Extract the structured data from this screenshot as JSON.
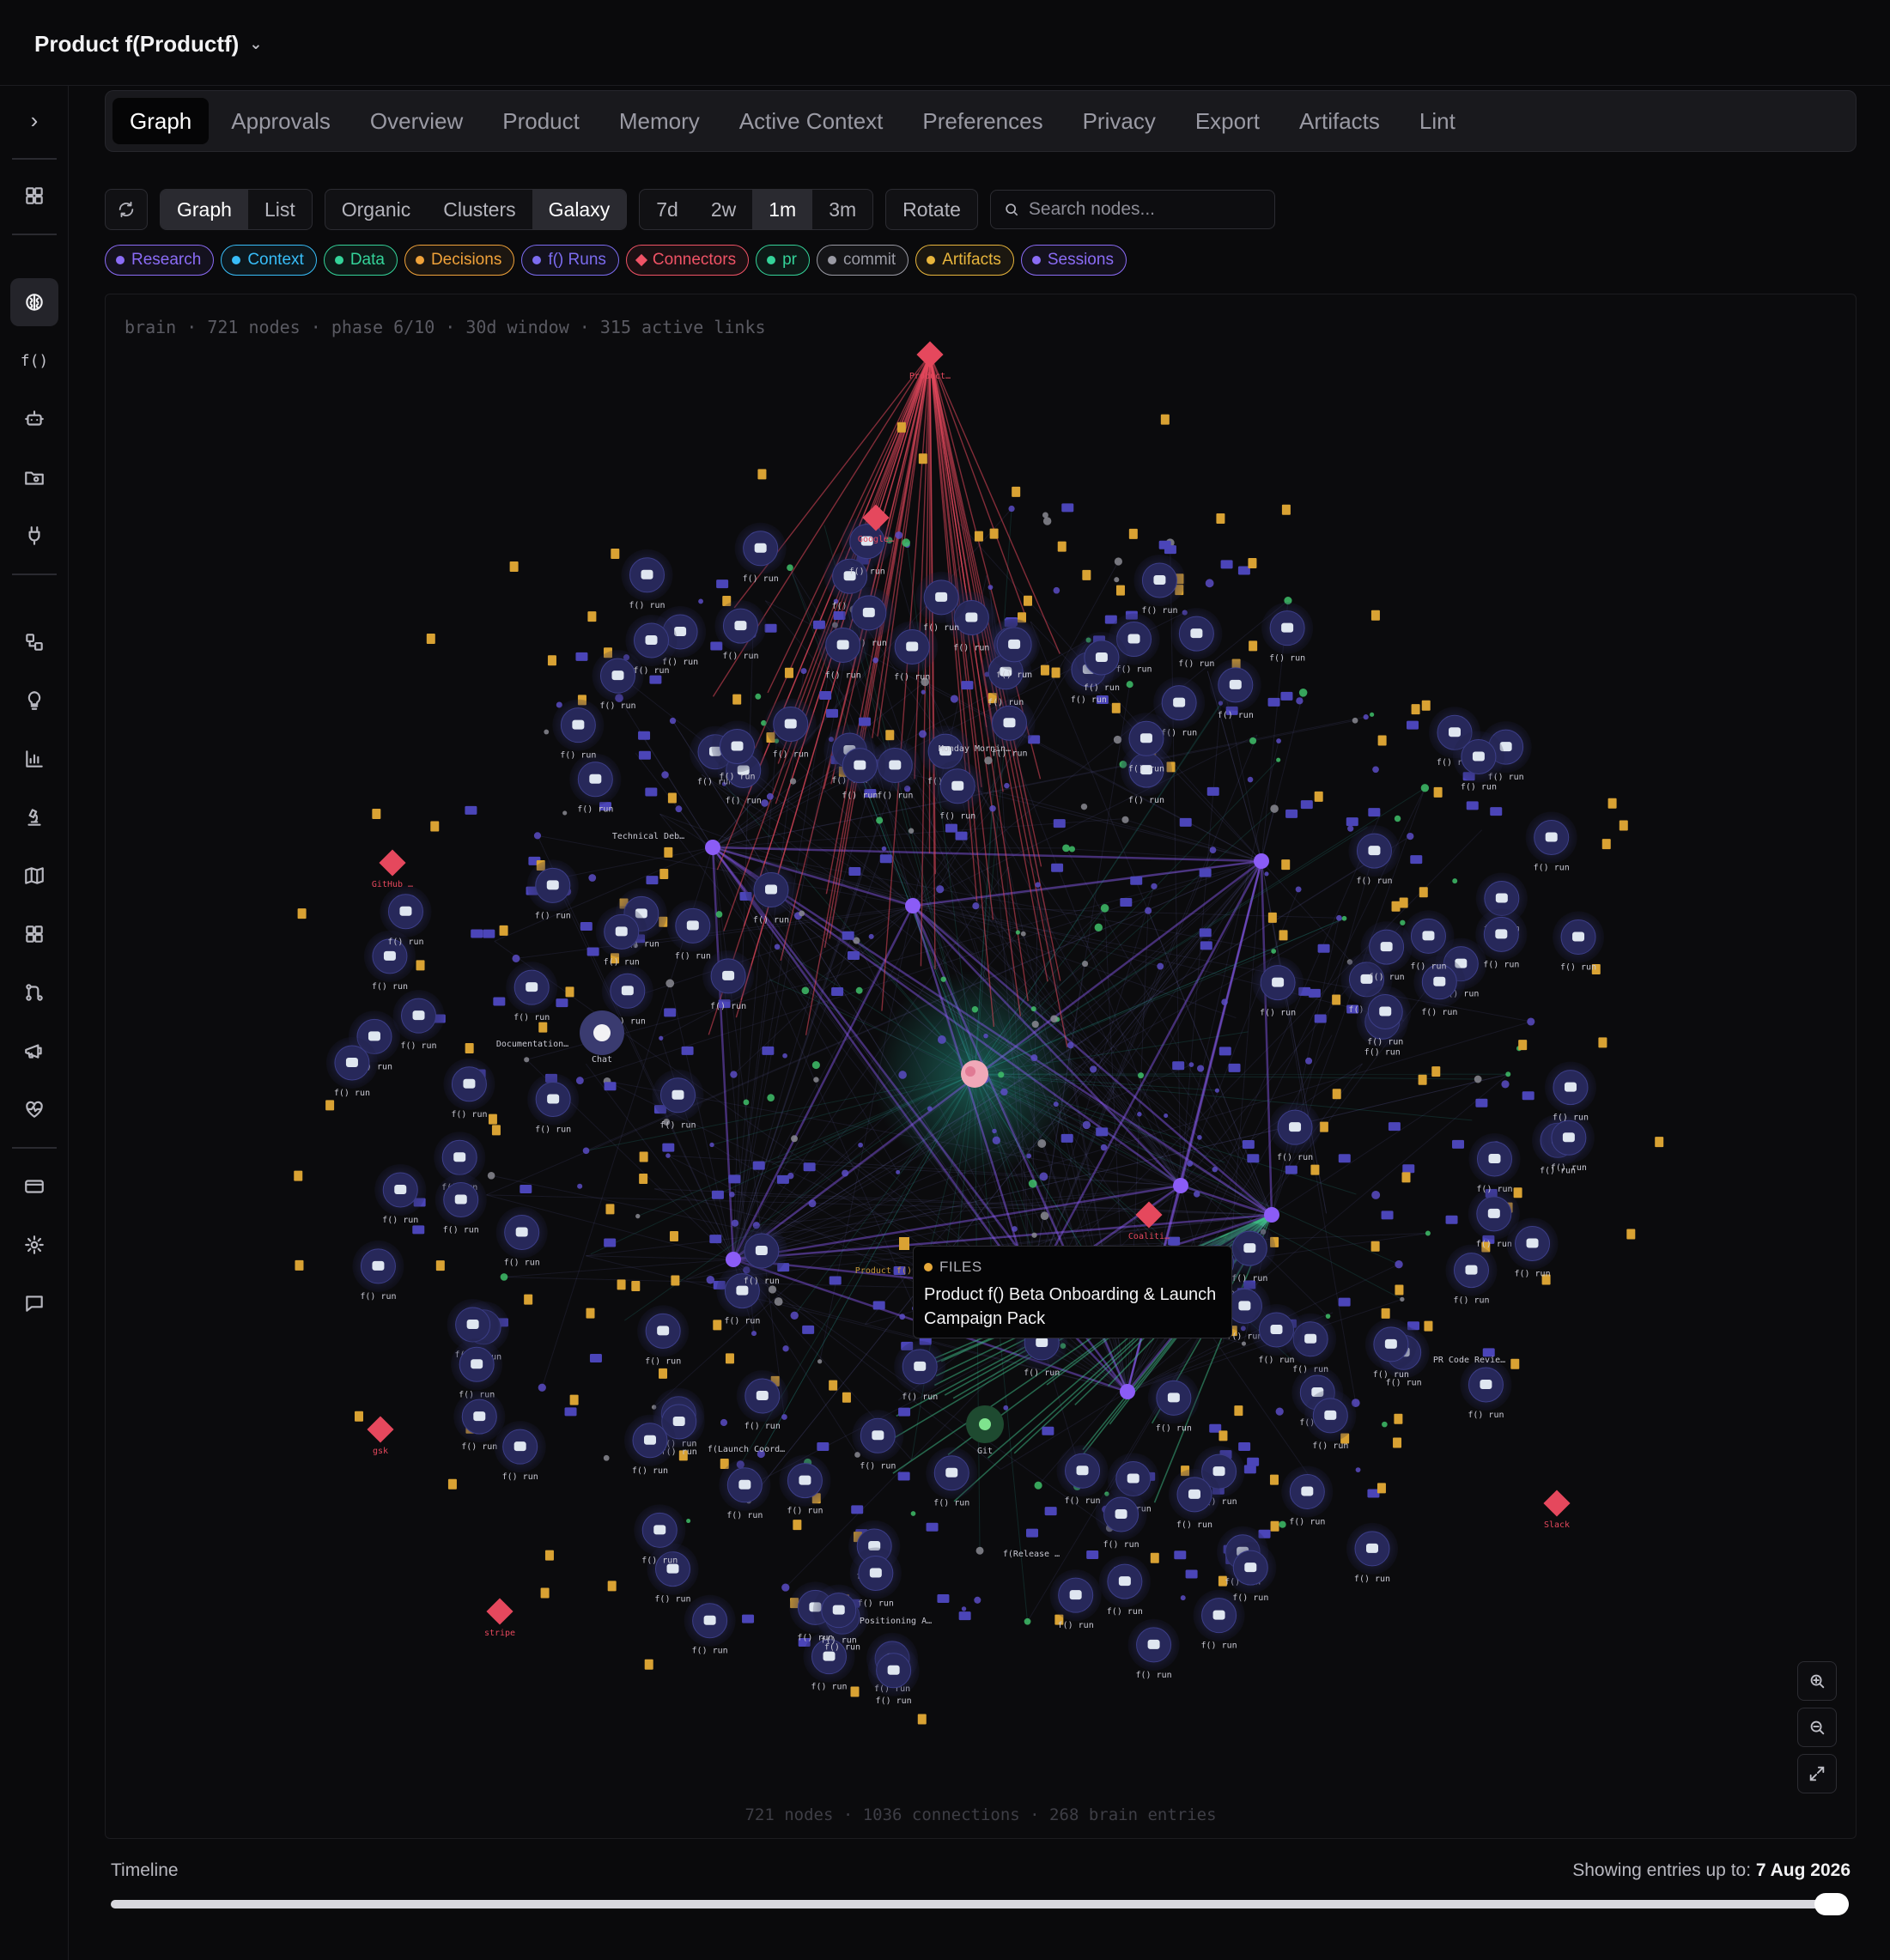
{
  "header": {
    "project_title": "Product f(Productf)"
  },
  "rail": {
    "items": [
      {
        "name": "expand-icon"
      },
      {
        "name": "dashboard-icon"
      },
      {
        "name": "brain-icon"
      },
      {
        "name": "function-label",
        "text": "f()"
      },
      {
        "name": "bot-icon"
      },
      {
        "name": "folder-icon"
      },
      {
        "name": "plug-icon"
      },
      {
        "name": "workflow-icon"
      },
      {
        "name": "lightbulb-icon"
      },
      {
        "name": "chart-icon"
      },
      {
        "name": "microscope-icon"
      },
      {
        "name": "map-icon"
      },
      {
        "name": "grid-icon"
      },
      {
        "name": "git-icon"
      },
      {
        "name": "megaphone-icon"
      },
      {
        "name": "heart-pulse-icon"
      },
      {
        "name": "card-icon"
      },
      {
        "name": "settings-icon"
      },
      {
        "name": "message-icon"
      }
    ],
    "function_label": "f()"
  },
  "tabs": [
    "Graph",
    "Approvals",
    "Overview",
    "Product",
    "Memory",
    "Active Context",
    "Preferences",
    "Privacy",
    "Export",
    "Artifacts",
    "Lint"
  ],
  "active_tab": "Graph",
  "toolbar": {
    "view_modes": [
      "Graph",
      "List"
    ],
    "active_view": "Graph",
    "layouts": [
      "Organic",
      "Clusters",
      "Galaxy"
    ],
    "active_layout": "Galaxy",
    "ranges": [
      "7d",
      "2w",
      "1m",
      "3m"
    ],
    "active_range": "1m",
    "rotate_label": "Rotate",
    "search_placeholder": "Search nodes..."
  },
  "filters": [
    {
      "label": "Research",
      "color": "#8b6cf6",
      "shape": "dot"
    },
    {
      "label": "Context",
      "color": "#38bdf8",
      "shape": "dot"
    },
    {
      "label": "Data",
      "color": "#34d399",
      "shape": "dot"
    },
    {
      "label": "Decisions",
      "color": "#f0a23a",
      "shape": "dot"
    },
    {
      "label": "f() Runs",
      "color": "#7c6cf0",
      "shape": "dot"
    },
    {
      "label": "Connectors",
      "color": "#f05366",
      "shape": "diamond"
    },
    {
      "label": "pr",
      "color": "#34d399",
      "shape": "dot"
    },
    {
      "label": "commit",
      "color": "#9a9aa4",
      "shape": "dot"
    },
    {
      "label": "Artifacts",
      "color": "#e8b53c",
      "shape": "dot"
    },
    {
      "label": "Sessions",
      "color": "#8b6cf6",
      "shape": "dot"
    }
  ],
  "graph": {
    "status_line": "brain · 721 nodes · phase 6/10 · 30d window · 315 active links",
    "footer_line": "721 nodes · 1036 connections · 268 brain entries",
    "run_label": "f() run",
    "labeled_nodes": [
      "Product…",
      "Google…",
      "GitHub …",
      "Technical Deb…",
      "Monday Mornin…",
      "Documentation…",
      "Chat",
      "Coaliti…",
      "Product f() Beta O…",
      "PR Code Revie…",
      "f(Launch Coord…",
      "f(Release …",
      "Positioning A…",
      "gsk",
      "stripe",
      "Slack",
      "Git"
    ],
    "tooltip": {
      "kind": "FILES",
      "title": "Product f() Beta Onboarding & Launch Campaign Pack"
    },
    "colors": {
      "connector": "#e5485d",
      "run_node": "#27285a",
      "file": "#d9a233",
      "tag": "#4b45b8",
      "hub": "#8b5cf6",
      "pr_link": "#3fbf8a"
    }
  },
  "zoom_controls": [
    "zoom-in-icon",
    "zoom-out-icon",
    "fullscreen-icon"
  ],
  "timeline": {
    "label": "Timeline",
    "status_prefix": "Showing entries up to:",
    "status_date": "7 Aug 2026",
    "position": 1.0
  }
}
